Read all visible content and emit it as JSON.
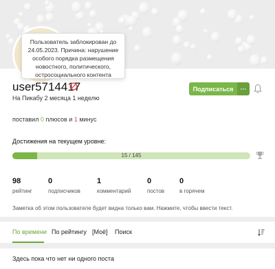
{
  "tooltip": {
    "text": "Пользователь заблокирован до 24.05.2023. Причина: нарушение особого порядка размещения новостного, политического, остросоциального контента"
  },
  "profile": {
    "username": "user5714417",
    "since": "На Пикабу 2 месяца 1 неделю",
    "subscribe_label": "Подписаться",
    "more_label": "···"
  },
  "votes": {
    "prefix": "поставил",
    "plus_count": "0",
    "plus_word": "плюсов и",
    "minus_count": "1",
    "minus_word": "минус"
  },
  "achievements": {
    "title": "Достижения на текущем уровне:",
    "progress_text": "15 / 145",
    "progress_value": 15,
    "progress_max": 145
  },
  "stats": [
    {
      "value": "98",
      "label": "рейтинг"
    },
    {
      "value": "0",
      "label": "подписчиков"
    },
    {
      "value": "1",
      "label": "комментарий"
    },
    {
      "value": "0",
      "label": "постов"
    },
    {
      "value": "0",
      "label": "в горячем"
    }
  ],
  "note": "Заметка об этом пользователе будет видна только вам. Нажмите, чтобы ввести текст.",
  "tabs": [
    {
      "label": "По времени",
      "active": true
    },
    {
      "label": "По рейтингу",
      "active": false
    },
    {
      "label": "[Моё]",
      "active": false
    },
    {
      "label": "Поиск",
      "active": false
    }
  ],
  "empty_text": "Здесь пока что нет ни одного поста",
  "colors": {
    "accent": "#7ab648",
    "minus": "#d44c4c",
    "progress_track": "#cfe5b8"
  },
  "icons": {
    "ban": "ban-icon",
    "bell": "bell-icon",
    "trophy": "trophy-icon",
    "sort": "sort-icon"
  }
}
